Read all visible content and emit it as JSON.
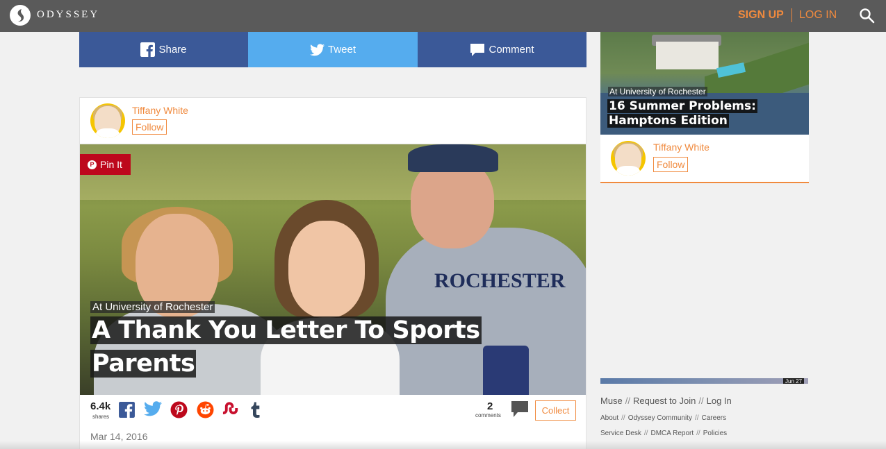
{
  "header": {
    "logo_text": "ODYSSEY",
    "signup_label": "SIGN UP",
    "login_label": "LOG IN",
    "search_icon": "search-icon"
  },
  "share_bar": {
    "facebook_label": "Share",
    "twitter_label": "Tweet",
    "comment_label": "Comment"
  },
  "article": {
    "author": "Tiffany White",
    "follow_label": "Follow",
    "pin_label": "Pin It",
    "location": "At University of Rochester",
    "title_line1": "A Thank You Letter To Sports",
    "title_line2": "Parents",
    "shares_count": "6.4k",
    "shares_label": "shares",
    "share_icons": [
      "facebook-icon",
      "twitter-icon",
      "pinterest-icon",
      "reddit-icon",
      "stumbleupon-icon",
      "tumblr-icon"
    ],
    "comments_count": "2",
    "comments_label": "comments",
    "collect_label": "Collect",
    "date": "Mar 14, 2016",
    "photo_jersey_text": "ROCHESTER"
  },
  "sidebar": {
    "card_location": "At University of Rochester",
    "card_title_line1": "16 Summer Problems:",
    "card_title_line2": "Hamptons Edition",
    "card_author": "Tiffany White",
    "card_follow_label": "Follow",
    "thumb_date": "Jun 27",
    "footer_links_main": [
      "Muse",
      "Request to Join",
      "Log In"
    ],
    "footer_links_row2": [
      "About",
      "Odyssey Community",
      "Careers"
    ],
    "footer_links_row3": [
      "Service Desk",
      "DMCA Report",
      "Policies"
    ]
  },
  "colors": {
    "brand_orange": "#f08a3e",
    "facebook_blue": "#3b5998",
    "twitter_blue": "#55acee",
    "pinterest_red": "#bd081c",
    "topbar_gray": "#5a5a5a"
  }
}
